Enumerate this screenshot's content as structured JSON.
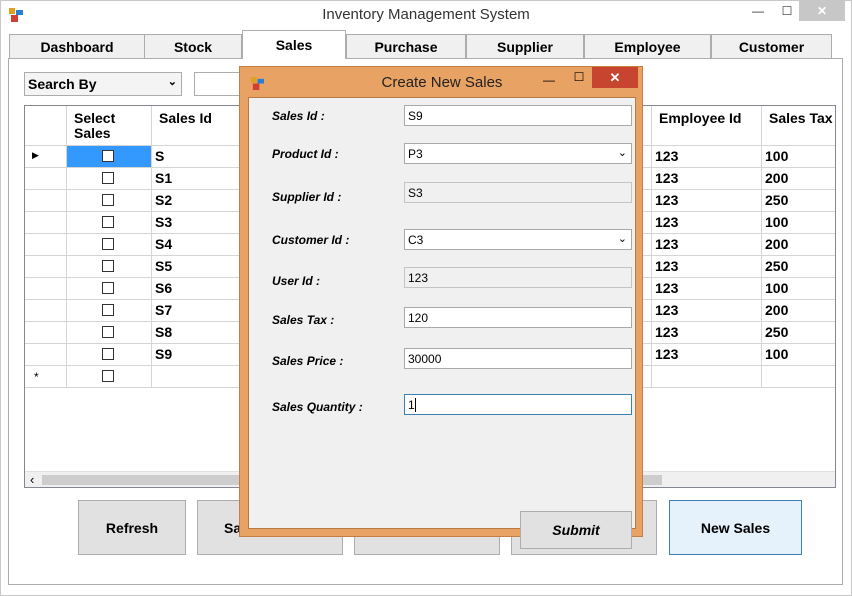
{
  "window": {
    "title": "Inventory Management System",
    "min_glyph": "—",
    "max_glyph": "☐",
    "close_glyph": "✕",
    "icon": "app-icon"
  },
  "tabs": [
    {
      "label": "Dashboard"
    },
    {
      "label": "Stock"
    },
    {
      "label": "Sales",
      "active": true
    },
    {
      "label": "Purchase"
    },
    {
      "label": "Supplier"
    },
    {
      "label": "Employee"
    },
    {
      "label": "Customer"
    }
  ],
  "search": {
    "by_label": "Search By",
    "value": ""
  },
  "grid": {
    "columns": [
      "Select Sales",
      "Sales Id",
      "Employee Id",
      "Sales Tax"
    ],
    "rows": [
      {
        "sales_id": "S",
        "employee_id": "123",
        "sales_tax": "100"
      },
      {
        "sales_id": "S1",
        "employee_id": "123",
        "sales_tax": "200"
      },
      {
        "sales_id": "S2",
        "employee_id": "123",
        "sales_tax": "250"
      },
      {
        "sales_id": "S3",
        "employee_id": "123",
        "sales_tax": "100"
      },
      {
        "sales_id": "S4",
        "employee_id": "123",
        "sales_tax": "200"
      },
      {
        "sales_id": "S5",
        "employee_id": "123",
        "sales_tax": "250"
      },
      {
        "sales_id": "S6",
        "employee_id": "123",
        "sales_tax": "100"
      },
      {
        "sales_id": "S7",
        "employee_id": "123",
        "sales_tax": "200"
      },
      {
        "sales_id": "S8",
        "employee_id": "123",
        "sales_tax": "250"
      },
      {
        "sales_id": "S9",
        "employee_id": "123",
        "sales_tax": "100"
      }
    ],
    "current_row_glyph": "▶",
    "new_row_glyph": "*",
    "scroll_left_glyph": "‹"
  },
  "buttons": {
    "refresh": "Refresh",
    "second_partial": "Sa",
    "new_sales": "New Sales"
  },
  "dialog": {
    "title": "Create New Sales",
    "min_glyph": "—",
    "max_glyph": "☐",
    "close_glyph": "✕",
    "fields": {
      "sales_id": {
        "label": "Sales Id :",
        "value": "S9"
      },
      "product_id": {
        "label": "Product Id :",
        "value": "P3"
      },
      "supplier_id": {
        "label": "Supplier Id :",
        "value": "S3"
      },
      "customer_id": {
        "label": "Customer Id :",
        "value": "C3"
      },
      "user_id": {
        "label": "User Id :",
        "value": "123"
      },
      "sales_tax": {
        "label": "Sales Tax :",
        "value": "120"
      },
      "sales_price": {
        "label": "Sales Price :",
        "value": "30000"
      },
      "sales_quantity": {
        "label": "Sales Quantity :",
        "value": "1"
      }
    },
    "submit_label": "Submit"
  },
  "chevron_glyph": "⌄",
  "colors": {
    "dialog_frame": "#e8a264",
    "close_button": "#c7452f",
    "selection": "#3399ff"
  }
}
